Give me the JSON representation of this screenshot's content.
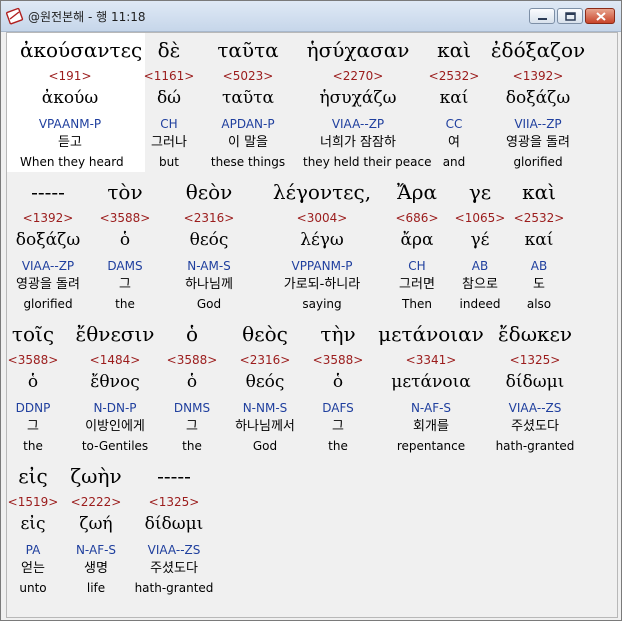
{
  "window": {
    "title": "@원전본해 - 행 11:18"
  },
  "colors": {
    "strongs": "#9b1c1c",
    "morph": "#1f3f9e"
  },
  "rows": [
    {
      "words": [
        {
          "greek": "ἀκούσαντες",
          "strongs": "<191>",
          "lemma": "ἀκούω",
          "morph": "VPAANM-P",
          "korean": "듣고",
          "english": "When they heard"
        },
        {
          "greek": "δὲ",
          "strongs": "<1161>",
          "lemma": "δώ",
          "morph": "CH",
          "korean": "그러나",
          "english": "but"
        },
        {
          "greek": "ταῦτα",
          "strongs": "<5023>",
          "lemma": "ταῦτα",
          "morph": "APDAN-P",
          "korean": "이 말을",
          "english": "these things"
        },
        {
          "greek": "ἡσύχασαν",
          "strongs": "<2270>",
          "lemma": "ἡσυχάζω",
          "morph": "VIAA--ZP",
          "korean": "너희가 잠잠하",
          "english": "they held their peace"
        },
        {
          "greek": "καὶ",
          "strongs": "<2532>",
          "lemma": "καί",
          "morph": "CC",
          "korean": "여",
          "english": "and"
        },
        {
          "greek": "ἐδόξαζον",
          "strongs": "<1392>",
          "lemma": "δοξάζω",
          "morph": "VIIA--ZP",
          "korean": "영광을 돌려",
          "english": "glorified"
        }
      ]
    },
    {
      "words": [
        {
          "greek": "-----",
          "strongs": "<1392>",
          "lemma": "δοξάζω",
          "morph": "VIAA--ZP",
          "korean": "영광을 돌려",
          "english": "glorified"
        },
        {
          "greek": "τὸν",
          "strongs": "<3588>",
          "lemma": "ὁ",
          "morph": "DAMS",
          "korean": "그",
          "english": "the"
        },
        {
          "greek": "θεὸν",
          "strongs": "<2316>",
          "lemma": "θεός",
          "morph": "N-AM-S",
          "korean": "하나님께",
          "english": "God"
        },
        {
          "greek": "λέγοντες,",
          "strongs": "<3004>",
          "lemma": "λέγω",
          "morph": "VPPANM-P",
          "korean": "가로되-하니라",
          "english": "saying"
        },
        {
          "greek": "Ἄρα",
          "strongs": "<686>",
          "lemma": "ἄρα",
          "morph": "CH",
          "korean": "그러면",
          "english": "Then"
        },
        {
          "greek": "γε",
          "strongs": "<1065>",
          "lemma": "γέ",
          "morph": "AB",
          "korean": "참으로",
          "english": "indeed"
        },
        {
          "greek": "καὶ",
          "strongs": "<2532>",
          "lemma": "καί",
          "morph": "AB",
          "korean": "도",
          "english": "also"
        }
      ]
    },
    {
      "words": [
        {
          "greek": "τοῖς",
          "strongs": "<3588>",
          "lemma": "ὁ",
          "morph": "DDNP",
          "korean": "그",
          "english": "the"
        },
        {
          "greek": "ἔθνεσιν",
          "strongs": "<1484>",
          "lemma": "ἔθνος",
          "morph": "N-DN-P",
          "korean": "이방인에게",
          "english": "to-Gentiles"
        },
        {
          "greek": "ὁ",
          "strongs": "<3588>",
          "lemma": "ὁ",
          "morph": "DNMS",
          "korean": "그",
          "english": "the"
        },
        {
          "greek": "θεὸς",
          "strongs": "<2316>",
          "lemma": "θεός",
          "morph": "N-NM-S",
          "korean": "하나님께서",
          "english": "God"
        },
        {
          "greek": "τὴν",
          "strongs": "<3588>",
          "lemma": "ὁ",
          "morph": "DAFS",
          "korean": "그",
          "english": "the"
        },
        {
          "greek": "μετάνοιαν",
          "strongs": "<3341>",
          "lemma": "μετάνοια",
          "morph": "N-AF-S",
          "korean": "회개를",
          "english": "repentance"
        },
        {
          "greek": "ἔδωκεν",
          "strongs": "<1325>",
          "lemma": "δίδωμι",
          "morph": "VIAA--ZS",
          "korean": "주셨도다",
          "english": "hath-granted"
        }
      ]
    },
    {
      "words": [
        {
          "greek": "εἰς",
          "strongs": "<1519>",
          "lemma": "εἰς",
          "morph": "PA",
          "korean": "얻는",
          "english": "unto"
        },
        {
          "greek": "ζωὴν",
          "strongs": "<2222>",
          "lemma": "ζωή",
          "morph": "N-AF-S",
          "korean": "생명",
          "english": "life"
        },
        {
          "greek": "-----",
          "strongs": "<1325>",
          "lemma": "δίδωμι",
          "morph": "VIAA--ZS",
          "korean": "주셨도다",
          "english": "hath-granted"
        }
      ]
    }
  ]
}
